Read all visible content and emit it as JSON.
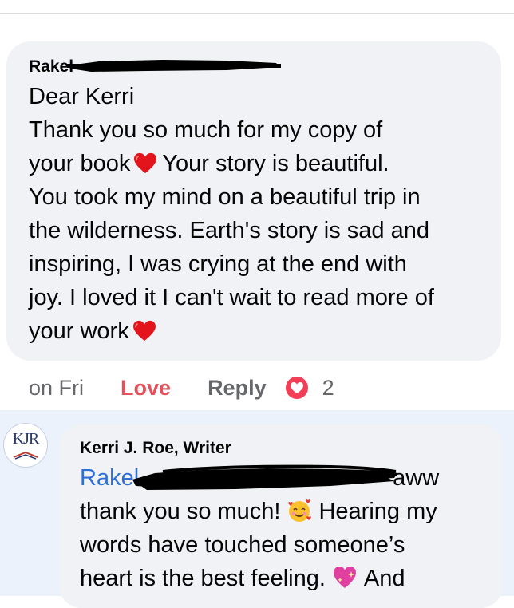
{
  "comment": {
    "author_visible": "Rakel",
    "lines": [
      "Dear Kerri",
      "Thank you so much for my copy of",
      "your book",
      "Your story is beautiful.",
      "You took my mind on a beautiful trip in",
      "the wilderness. Earth's story is sad and",
      "inspiring, I was crying at the end with",
      "joy. I loved it I can't wait to read more of",
      "your work"
    ],
    "heart_icon": "red-heart-icon",
    "redaction": "black-scribble"
  },
  "actions": {
    "time": "on Fri",
    "love": "Love",
    "reply": "Reply",
    "reaction_icon": "love-reaction-icon",
    "reaction_count": "2",
    "love_color": "#e4515c"
  },
  "reply": {
    "avatar_initials": "KJR",
    "author": "Kerri J. Roe, Writer",
    "mention": "Rakel",
    "after_mention": "aww",
    "lines": [
      "thank you so much!",
      "Hearing my",
      "words have touched someone’s",
      "heart is the best feeling.",
      "And"
    ],
    "emoji_1": "smiling-face-with-hearts-icon",
    "emoji_2": "sparkling-heart-icon",
    "mention_color": "#2e6fd6",
    "band_color": "#ebf2fc"
  }
}
